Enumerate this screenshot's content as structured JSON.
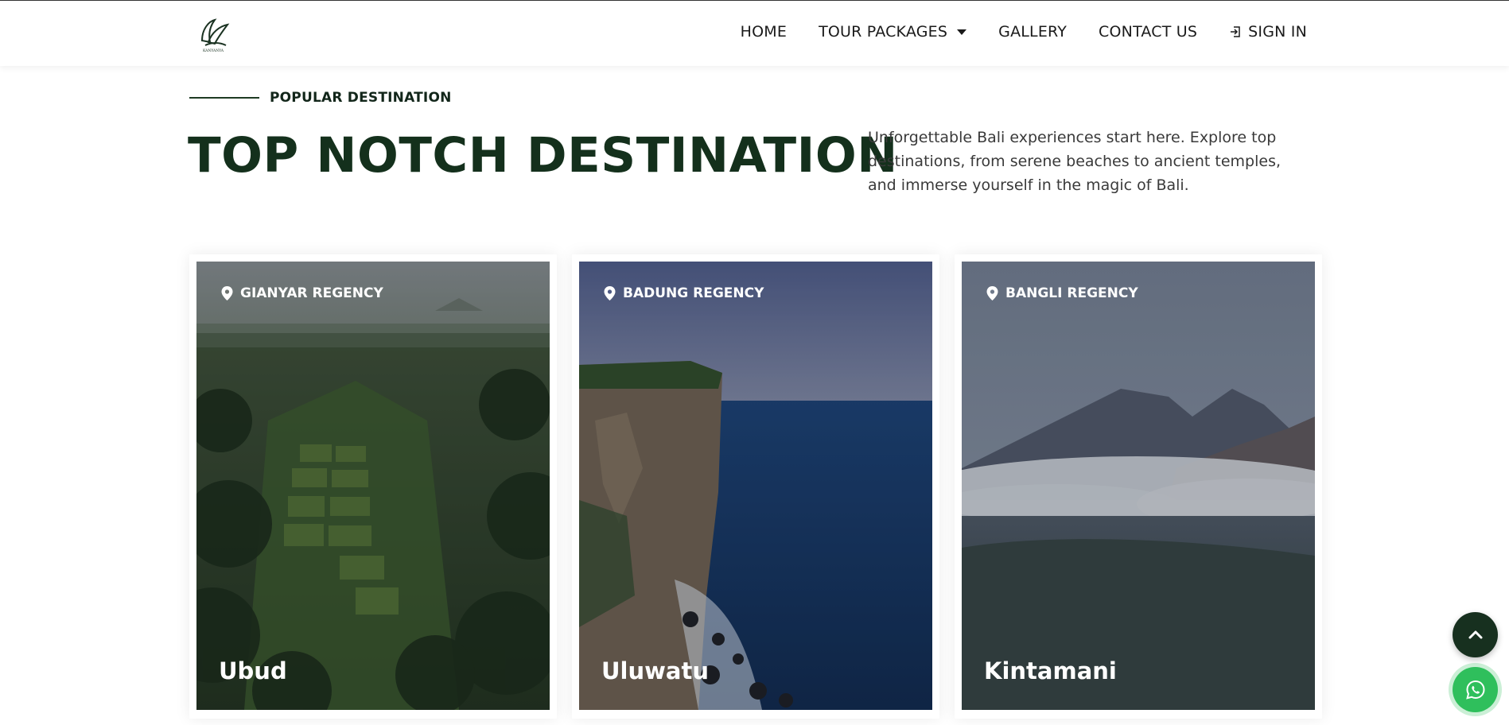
{
  "brand": {
    "logo_icon": "leaf-logo-icon",
    "logo_text": "KANYANYA"
  },
  "nav": {
    "items": [
      {
        "label": "HOME"
      },
      {
        "label": "TOUR PACKAGES",
        "has_dropdown": true
      },
      {
        "label": "GALLERY"
      },
      {
        "label": "CONTACT US"
      }
    ],
    "signin_label": "SIGN IN"
  },
  "section": {
    "eyebrow": "POPULAR DESTINATION",
    "title": "TOP NOTCH DESTINATION",
    "description": "Unforgettable Bali experiences start here. Explore top destinations, from serene beaches to ancient temples, and immerse yourself in the magic of Bali."
  },
  "cards": [
    {
      "region": "GIANYAR REGENCY",
      "title": "Ubud",
      "scene": "rice-terrace-jungle"
    },
    {
      "region": "BADUNG REGENCY",
      "title": "Uluwatu",
      "scene": "sea-cliff-ocean"
    },
    {
      "region": "BANGLI REGENCY",
      "title": "Kintamani",
      "scene": "mountains-clouds"
    }
  ],
  "floating": {
    "scroll_top_icon": "chevron-up-icon",
    "chat_icon": "whatsapp-icon"
  },
  "colors": {
    "brand_dark": "#14301c",
    "whatsapp": "#2fbf5c"
  }
}
